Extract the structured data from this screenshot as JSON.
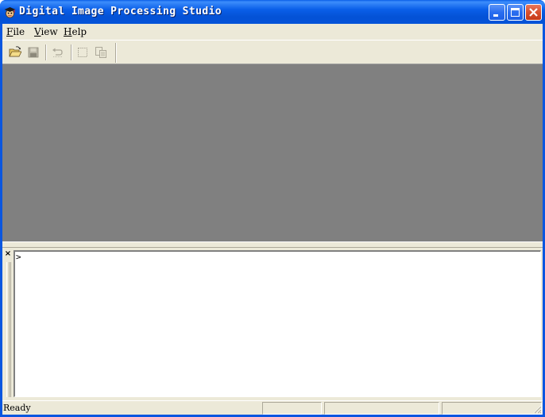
{
  "window": {
    "title": "Digital Image Processing Studio",
    "app_icon": "graduate-cap-icon",
    "controls": [
      "minimize-icon",
      "maximize-icon",
      "close-icon"
    ]
  },
  "menubar": {
    "items": [
      {
        "access_key": "F",
        "rest": "ile"
      },
      {
        "access_key": "V",
        "rest": "iew"
      },
      {
        "access_key": "H",
        "rest": "elp"
      }
    ]
  },
  "toolbar": {
    "buttons": [
      {
        "icon": "open-folder-icon",
        "enabled": true
      },
      {
        "icon": "save-icon",
        "enabled": false
      },
      {
        "icon": "undo-icon",
        "enabled": false
      },
      {
        "icon": "select-icon",
        "enabled": false
      },
      {
        "icon": "copy-icon",
        "enabled": false
      }
    ]
  },
  "workspace": {
    "background": "#808080"
  },
  "output_pane": {
    "close_glyph": "×",
    "prompt": ">"
  },
  "statusbar": {
    "text": "Ready",
    "panels": [
      "",
      "",
      ""
    ]
  },
  "colors": {
    "titlebar": "#0a5fe8",
    "chrome": "#ece9d8",
    "workspace": "#808080",
    "close_button": "#d8502e"
  }
}
